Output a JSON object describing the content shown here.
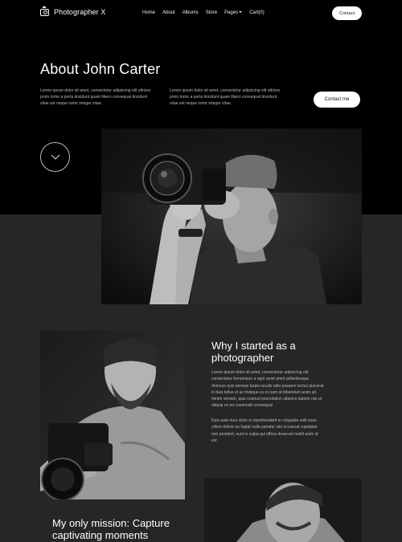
{
  "brand": {
    "name": "Photographer X",
    "icon": "camera-icon"
  },
  "nav": {
    "items": [
      "Home",
      "About",
      "Albums",
      "Store",
      "Pages",
      "Cart(0)"
    ],
    "contact_label": "Contact"
  },
  "hero": {
    "title": "About John Carter",
    "para1": "Lorem ipsum dolor sit amet, consectetur adipiscing elit ultrices proin tortor a porta tincidunt quam libero consequat tincidunt vitae est neque tortor integer vitae.",
    "para2": "Lorem ipsum dolor sit amet, consectetur adipiscing elit ultrices proin tortor a porta tincidunt quam libero consequat tincidunt vitae est neque tortor integer vitae.",
    "contact_label": "Contact me",
    "scroll_icon": "chevron-down-icon"
  },
  "section1": {
    "title": "Why I started as a photographer",
    "para1": "Lorem ipsum dolor sit amet, consectetur adipiscing elit consectetur fermentum a eget amet amet pellentesque rhoncus quis aenean turpis iaculis odio posuere lectus placerat in duis tellus et ac tristique eu in nam at bibendum anim ad minim veniam, quis nostrud exercitation ullamco laboris nisi ut aliquip ex ea commodo consequat",
    "para2": "Duis aute irure dolor in reprehenderit in voluptate velit esse cillum dolore eu fugiat nulla pariatur sint occaecat cupidatat non proident, sunt in culpa qui officia deserunt mollit anim id est"
  },
  "section2": {
    "title": "My only mission: Capture captivating moments"
  },
  "colors": {
    "hero_bg": "#000000",
    "section_bg": "#262626",
    "button_bg": "#ffffff"
  }
}
